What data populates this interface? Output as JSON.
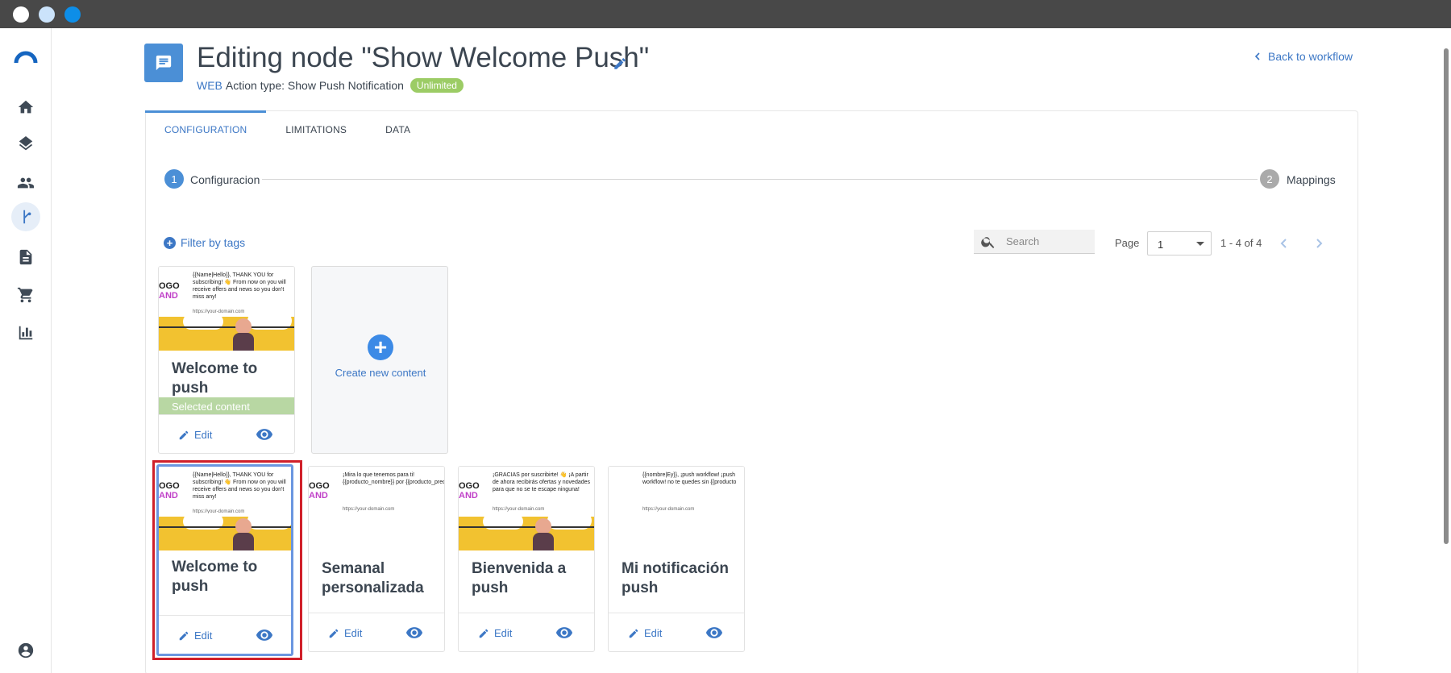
{
  "window": {
    "controls": [
      "close",
      "minimize",
      "maximize"
    ]
  },
  "sidebar": {
    "items": [
      {
        "icon": "home-icon",
        "active": false
      },
      {
        "icon": "layers-icon",
        "active": false
      },
      {
        "icon": "users-icon",
        "active": false
      },
      {
        "icon": "workflow-icon",
        "active": true
      },
      {
        "icon": "document-icon",
        "active": false
      },
      {
        "icon": "cart-icon",
        "active": false
      },
      {
        "icon": "chart-icon",
        "active": false
      },
      {
        "icon": "account-icon",
        "active": false
      }
    ]
  },
  "header": {
    "title": "Editing node \"Show Welcome Push\"",
    "channel": "WEB",
    "action_type": "Action type: Show Push Notification",
    "badge": "Unlimited",
    "back_link": "Back to workflow"
  },
  "tabs": [
    {
      "label": "CONFIGURATION",
      "active": true
    },
    {
      "label": "LIMITATIONS",
      "active": false
    },
    {
      "label": "DATA",
      "active": false
    }
  ],
  "stepper": {
    "steps": [
      {
        "number": "1",
        "label": "Configuracion",
        "active": true
      },
      {
        "number": "2",
        "label": "Mappings",
        "active": false
      }
    ]
  },
  "toolbar": {
    "filter_label": "Filter by tags",
    "search_placeholder": "Search",
    "page_label": "Page",
    "page_value": "1",
    "range": "1 - 4 of 4"
  },
  "selected_card": {
    "title": "Welcome to push",
    "selected_label": "Selected content",
    "edit_label": "Edit",
    "thumb": {
      "brand_line1": "OGO",
      "brand_line2": "AND",
      "message": "{{Name|Hello}}, THANK YOU for subscribing! 👋 From now on you will receive offers and news so you don't miss any!",
      "url": "https://your-domain.com"
    }
  },
  "create_new": {
    "label": "Create new content"
  },
  "cards": [
    {
      "title": "Welcome to push",
      "edit_label": "Edit",
      "highlighted": true,
      "thumb": {
        "brand_line1": "OGO",
        "brand_line2": "AND",
        "message": "{{Name|Hello}}, THANK YOU for subscribing! 👋 From now on you will receive offers and news so you don't miss any!",
        "url": "https://your-domain.com",
        "banner": true
      }
    },
    {
      "title": "Semanal personalizada",
      "edit_label": "Edit",
      "highlighted": false,
      "thumb": {
        "brand_line1": "OGO",
        "brand_line2": "AND",
        "message": "¡Mira lo que tenemos para ti! {{producto_nombre}} por {{producto_prec",
        "url": "https://your-domain.com",
        "banner": false
      }
    },
    {
      "title": "Bienvenida a push",
      "edit_label": "Edit",
      "highlighted": false,
      "thumb": {
        "brand_line1": "OGO",
        "brand_line2": "AND",
        "message": "¡GRACIAS por suscribirte! 👋 ¡A partir de ahora recibirás ofertas y novedades para que no se te escape ninguna!",
        "url": "https://your-domain.com",
        "banner": true
      }
    },
    {
      "title": "Mi notificación push",
      "edit_label": "Edit",
      "highlighted": false,
      "thumb": {
        "brand_line1": "",
        "brand_line2": "",
        "message": "{{nombre|Ey}}, ¡push workflow! ¡push workflow! no te quedes sin {{producto",
        "url": "https://your-domain.com",
        "banner": false
      }
    }
  ],
  "colors": {
    "accent": "#3c77c5",
    "header_icon": "#4b8fd6",
    "badge": "#9ccc65",
    "selected_bar": "#b8d7a3",
    "highlight": "#d0202a"
  }
}
